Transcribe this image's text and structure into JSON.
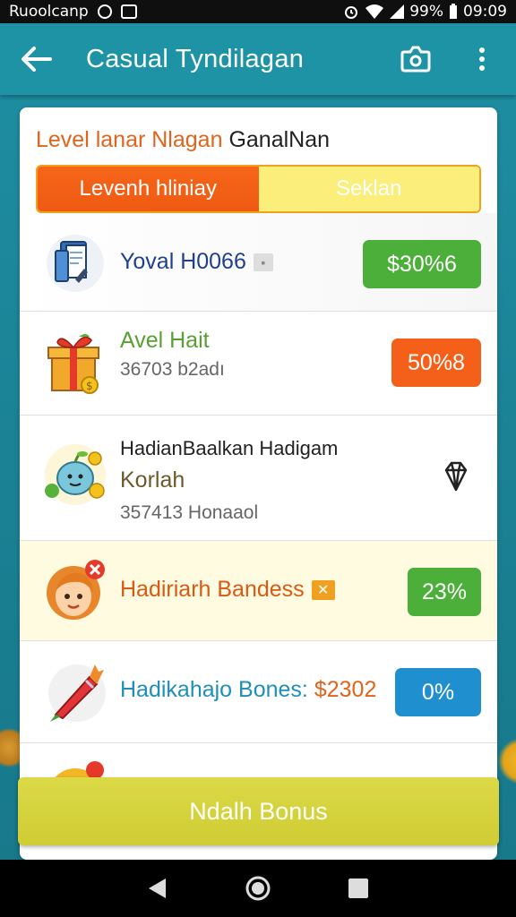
{
  "status_bar": {
    "carrier": "Ruoolcanp",
    "battery": "99%",
    "time": "09:09"
  },
  "app_bar": {
    "title": "Casual Tyndilagan",
    "icons": [
      "back-arrow-icon",
      "camera-icon",
      "more-vert-icon"
    ]
  },
  "card": {
    "title_part1": "Level lanar Nlagan",
    "title_part2": "GanalNan",
    "tabs": [
      {
        "label": "Levenh hliniay",
        "active": true
      },
      {
        "label": "Seklan",
        "active": false
      }
    ],
    "rows": [
      {
        "title": "Yoval H0066",
        "subtitle": "",
        "action": "$30%6",
        "action_color": "#4caf3a",
        "icon": "book-icon"
      },
      {
        "title": "Avel Hait",
        "subtitle": "36703  b2adı",
        "action": "50%8",
        "action_color": "#f4601a",
        "icon": "gift-box-icon"
      },
      {
        "title": "HadianBaalkan Hadigam",
        "title2": "Korlah",
        "subtitle": "357413 Honaaol",
        "action": "",
        "icon": "fruit-character-icon",
        "action_icon": "diamond-icon"
      },
      {
        "title": "Hadiriarh Bandess",
        "subtitle": "",
        "action": "23%",
        "action_color": "#4caf3a",
        "icon": "girl-avatar-icon"
      },
      {
        "title": "Hadikahajo Bones:",
        "title_accent": "$2302",
        "subtitle": "",
        "action": "0%",
        "action_color": "#1f8fcf",
        "icon": "carrot-icon"
      }
    ]
  },
  "cta": {
    "label": "Ndalh Bonus"
  },
  "colors": {
    "teal": "#1e93a6",
    "orange": "#f4601a",
    "green": "#4caf3a",
    "blue": "#1f8fcf",
    "yellow_button": "#d8d540"
  }
}
